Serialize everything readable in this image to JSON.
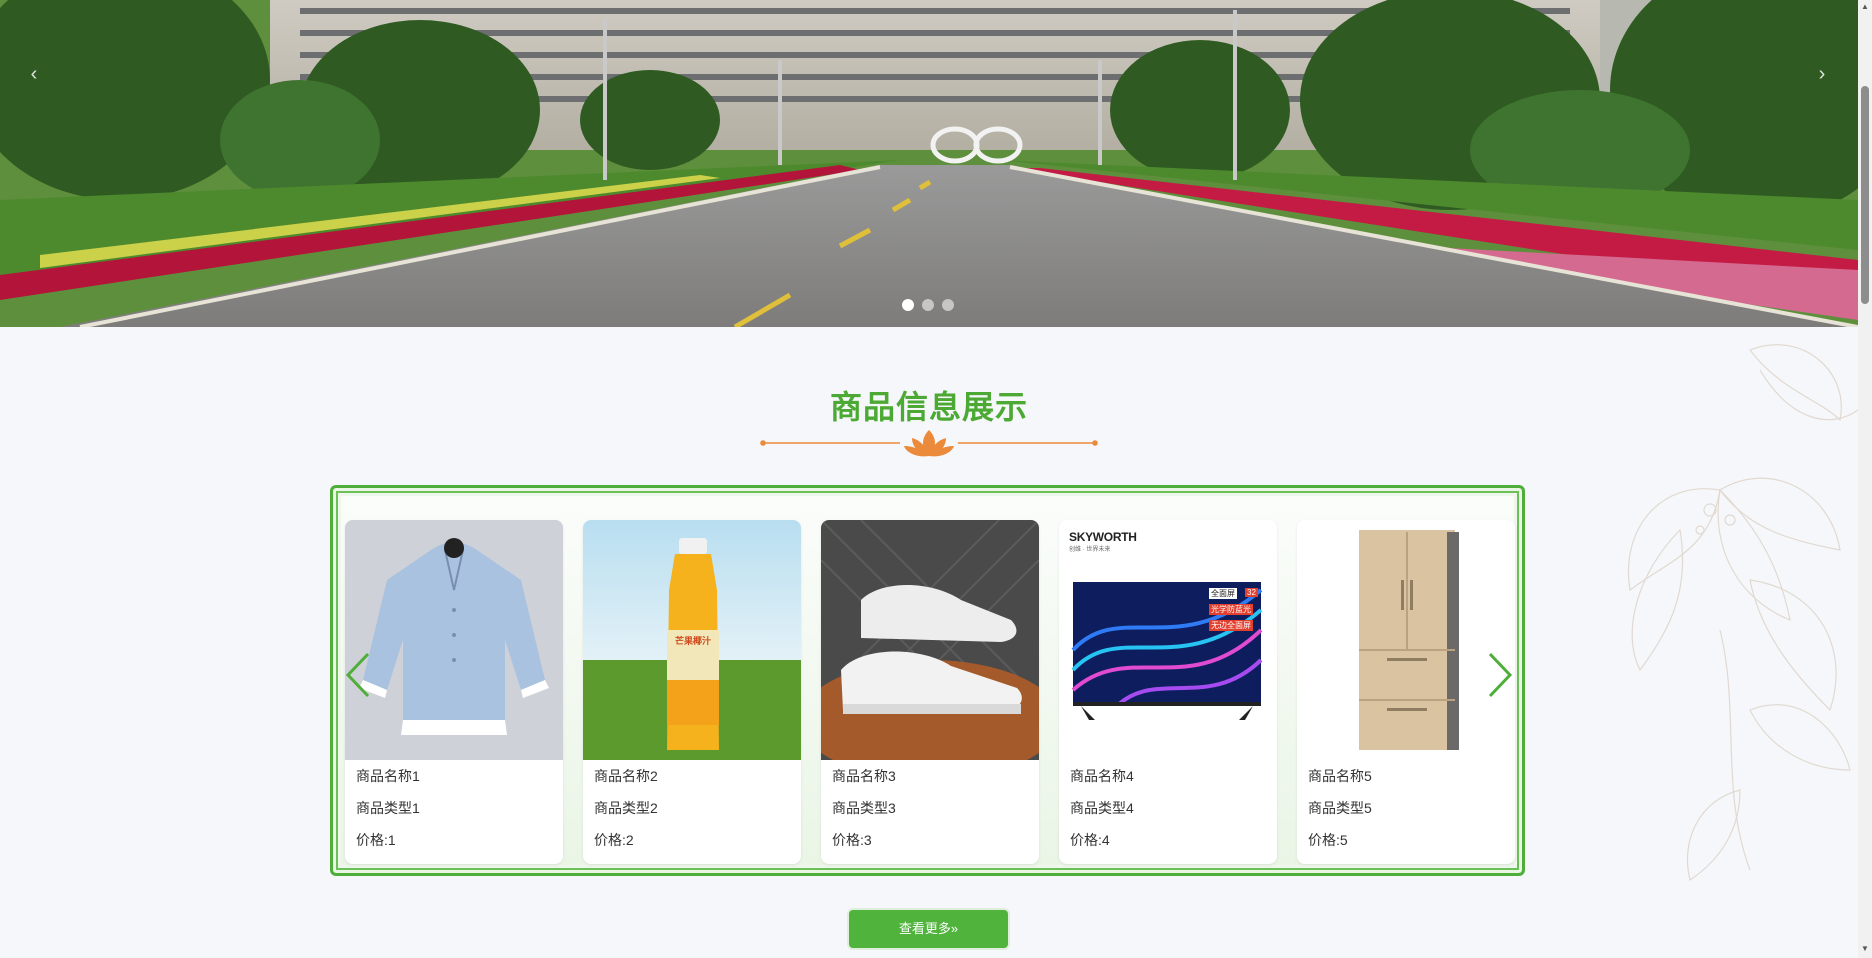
{
  "banner": {
    "prev_icon": "‹",
    "next_icon": "›",
    "slides": 3,
    "active_slide": 1
  },
  "section": {
    "title": "商品信息展示"
  },
  "products": [
    {
      "name": "商品名称1",
      "type": "商品类型1",
      "price": "价格:1",
      "image": "blue-shirt"
    },
    {
      "name": "商品名称2",
      "type": "商品类型2",
      "price": "价格:2",
      "image": "mango-juice-bottle",
      "bottle_label": "芒果椰汁"
    },
    {
      "name": "商品名称3",
      "type": "商品类型3",
      "price": "价格:3",
      "image": "white-sneakers"
    },
    {
      "name": "商品名称4",
      "type": "商品类型4",
      "price": "价格:4",
      "image": "tv",
      "brand": "SKYWORTH",
      "brand_sub": "创维 · 世界未来",
      "badges": [
        "全面屏",
        "光学防蓝光",
        "无边全面屏"
      ],
      "size_badge": "32"
    },
    {
      "name": "商品名称5",
      "type": "商品类型5",
      "price": "价格:5",
      "image": "refrigerator"
    }
  ],
  "more_button": {
    "label": "查看更多»"
  },
  "colors": {
    "accent": "#4caa34",
    "ornament": "#ec8a3c"
  }
}
